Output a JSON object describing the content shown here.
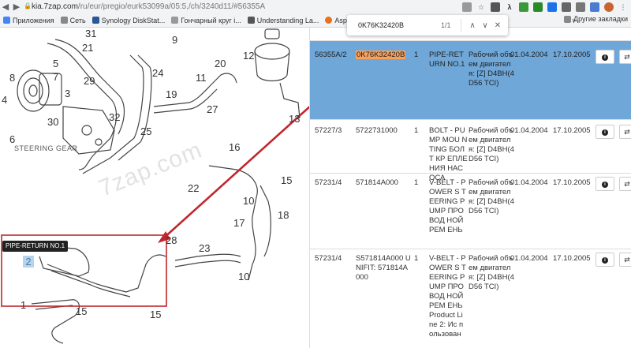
{
  "browser": {
    "url_host": "kia.7zap.com",
    "url_path": "/ru/eur/pregio/eurk53099a/05:5,/ch/3240d11/#56355A",
    "find": {
      "query": "0K76K32420B",
      "count": "1/1"
    }
  },
  "bookmarks": [
    {
      "label": "Приложения",
      "color": "#4285f4"
    },
    {
      "label": "Сеть",
      "color": "#888888"
    },
    {
      "label": "Synology DiskStat...",
      "color": "#2b5797"
    },
    {
      "label": "Гончарный круг i...",
      "color": "#999999"
    },
    {
      "label": "Understanding La...",
      "color": "#555555"
    },
    {
      "label": "Aspire Tabletop P...",
      "color": "#e8711c"
    }
  ],
  "bookmarks_more": "»",
  "bookmarks_other": "Другие закладки",
  "diagram": {
    "tooltip": "PIPE-RETURN NO.1",
    "highlighted_callout": "2",
    "watermark": "7zap.com",
    "steering_label": "STEERING GEAR",
    "callouts": [
      {
        "n": "31"
      },
      {
        "n": "21"
      },
      {
        "n": "5"
      },
      {
        "n": "7"
      },
      {
        "n": "8"
      },
      {
        "n": "24"
      },
      {
        "n": "4"
      },
      {
        "n": "29"
      },
      {
        "n": "3"
      },
      {
        "n": "30"
      },
      {
        "n": "32"
      },
      {
        "n": "6"
      },
      {
        "n": "9"
      },
      {
        "n": "19"
      },
      {
        "n": "20"
      },
      {
        "n": "11"
      },
      {
        "n": "12"
      },
      {
        "n": "25"
      },
      {
        "n": "27"
      },
      {
        "n": "13"
      },
      {
        "n": "16"
      },
      {
        "n": "22"
      },
      {
        "n": "15"
      },
      {
        "n": "10"
      },
      {
        "n": "18"
      },
      {
        "n": "17"
      },
      {
        "n": "28"
      },
      {
        "n": "23"
      },
      {
        "n": "10"
      },
      {
        "n": "1"
      },
      {
        "n": "15"
      },
      {
        "n": "15"
      }
    ]
  },
  "top_partial_desc": "TCI)",
  "rows": [
    {
      "code": "56355A/2",
      "number": "0K76K32420B",
      "qty": "1",
      "name": "PIPE-RET URN NO.1",
      "desc": "Рабочий объем двигателя: [Z] D4BH(4D56 TCI)",
      "from": "01.04.2004",
      "to": "17.10.2005",
      "selected": true
    },
    {
      "code": "57227/3",
      "number": "5722731000",
      "qty": "1",
      "name": "BOLT - PU MP MOU NTING БОЛТ КР ЕПЛЕНИЯ НАСОСА",
      "desc": "Рабочий объем двигателя: [Z] D4BH(4D56 TCI)",
      "from": "01.04.2004",
      "to": "17.10.2005",
      "selected": false
    },
    {
      "code": "57231/4",
      "number": "571814A000",
      "qty": "1",
      "name": "V-BELT - POWER S TEERING PUMP ПРОВОД НОЙ РЕМ ЕНЬ",
      "desc": "Рабочий объем двигателя: [Z] D4BH(4D56 TCI)",
      "from": "01.04.2004",
      "to": "17.10.2005",
      "selected": false
    },
    {
      "code": "57231/4",
      "number": "S571814A000 UNIFIT: 571814A000",
      "qty": "1",
      "name": "V-BELT - POWER S TEERING PUMP ПРОВОД НОЙ РЕМ ЕНЬ Product Li ne 2: Ис п ользован",
      "desc": "Рабочий объем двигателя: [Z] D4BH(4D56 TCI)",
      "from": "01.04.2004",
      "to": "17.10.2005",
      "selected": false
    }
  ],
  "colors": {
    "selected_row": "#6ea7d8",
    "highlight": "#f7a05a",
    "arrow": "#c0272d"
  }
}
